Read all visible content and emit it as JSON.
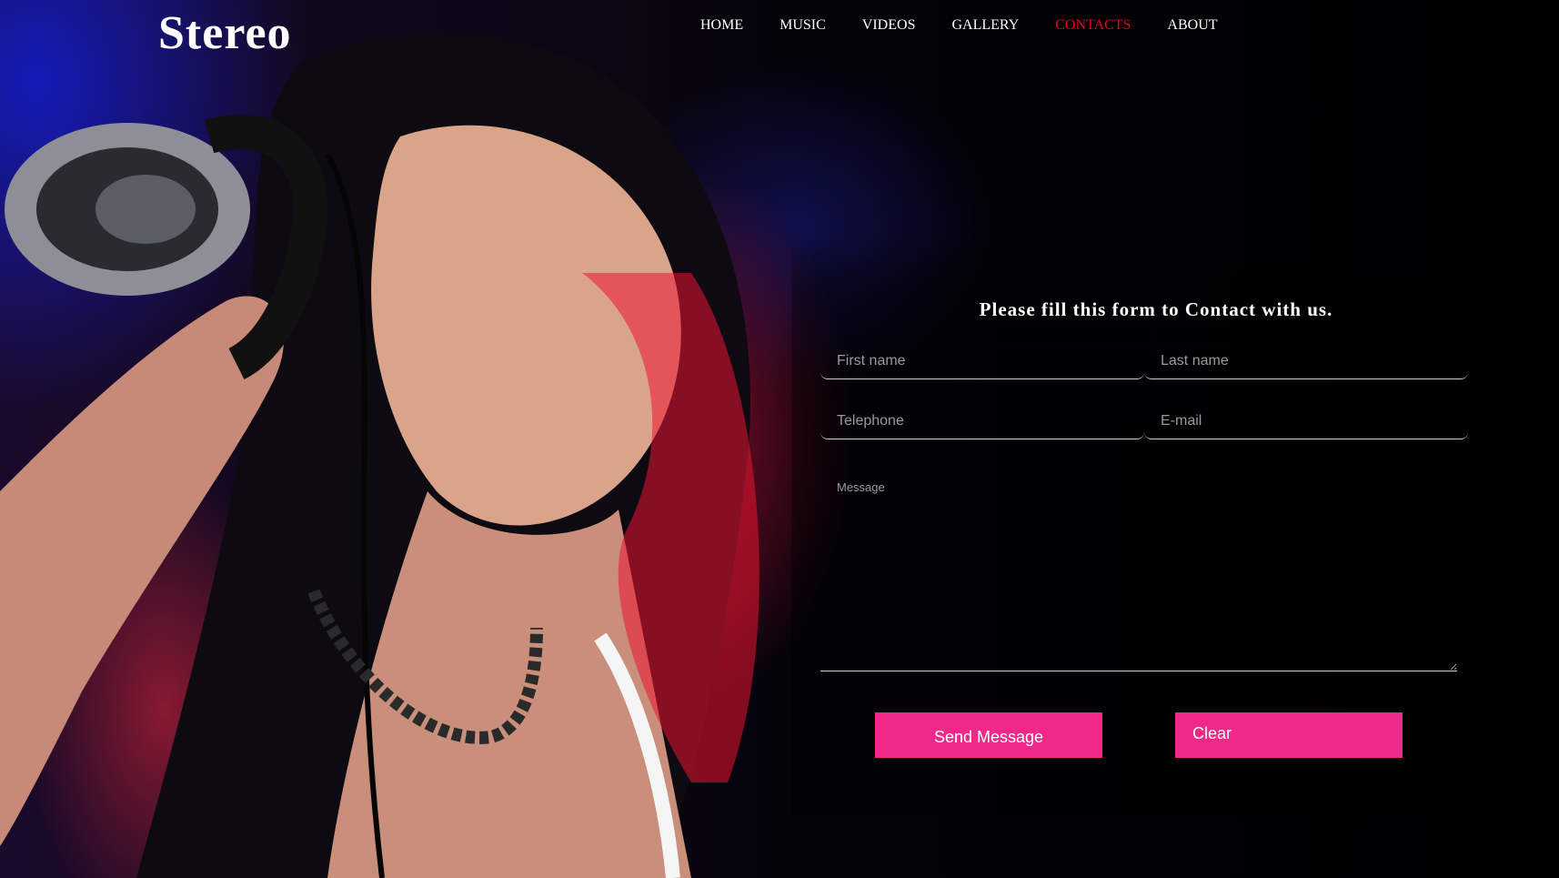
{
  "site": {
    "logo": "Stereo"
  },
  "nav": {
    "items": [
      {
        "label": "HOME",
        "active": false
      },
      {
        "label": "MUSIC",
        "active": false
      },
      {
        "label": "VIDEOS",
        "active": false
      },
      {
        "label": "GALLERY",
        "active": false
      },
      {
        "label": "CONTACTS",
        "active": true
      },
      {
        "label": "ABOUT",
        "active": false
      }
    ],
    "active_color": "#e8001c"
  },
  "form": {
    "title": "Please fill this form to Contact with us.",
    "first_name_placeholder": "First name",
    "last_name_placeholder": "Last name",
    "telephone_placeholder": "Telephone",
    "email_placeholder": "E-mail",
    "message_placeholder": "Message",
    "send_label": "Send Message",
    "clear_label": "Clear",
    "button_color": "#f0288a"
  },
  "background": {
    "image": "dj-woman-headphones-photo"
  }
}
